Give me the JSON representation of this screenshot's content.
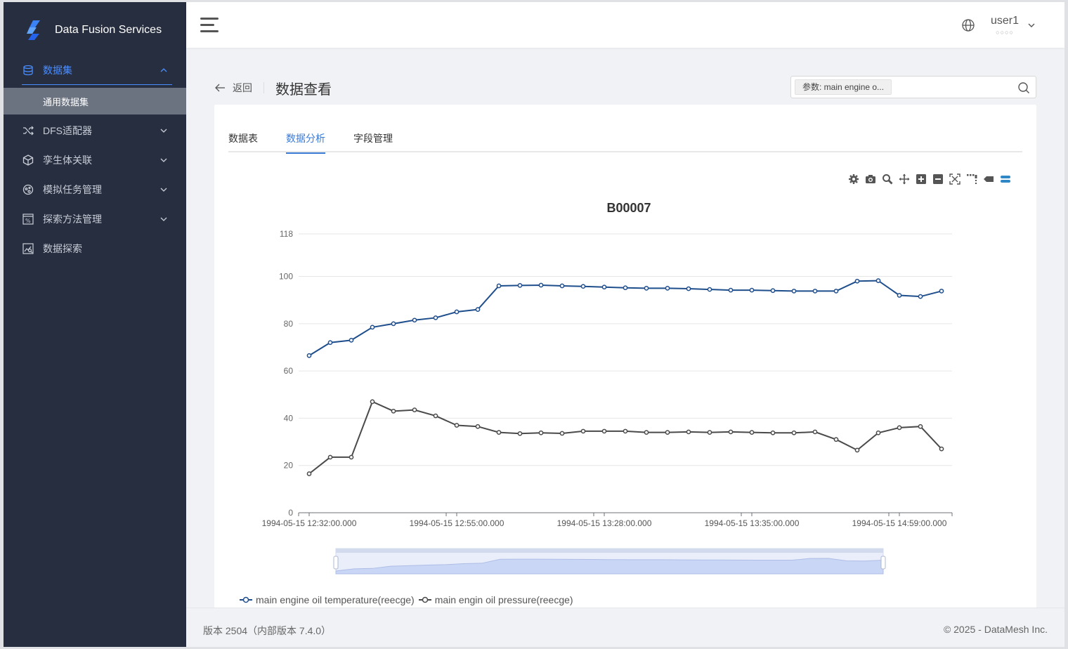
{
  "app": {
    "name": "Data Fusion Services"
  },
  "sidebar": {
    "items": [
      {
        "label": "数据集",
        "icon": "database-icon",
        "active": true
      },
      {
        "label": "通用数据集",
        "sub": true
      },
      {
        "label": "DFS适配器",
        "icon": "shuffle-icon"
      },
      {
        "label": "孪生体关联",
        "icon": "cube-icon"
      },
      {
        "label": "模拟任务管理",
        "icon": "task-icon"
      },
      {
        "label": "探索方法管理",
        "icon": "percent-icon"
      },
      {
        "label": "数据探索",
        "icon": "chart-explore-icon"
      }
    ]
  },
  "header": {
    "user_name": "user1",
    "user_sub": "○○○○"
  },
  "page": {
    "back_label": "返回",
    "title": "数据查看",
    "search_tag": "参数: main engine o..."
  },
  "tabs": [
    {
      "label": "数据表"
    },
    {
      "label": "数据分析",
      "active": true
    },
    {
      "label": "字段管理"
    }
  ],
  "toolbox": [
    "settings-icon",
    "camera-icon",
    "zoom-icon",
    "move-icon",
    "plus-box-icon",
    "minus-box-icon",
    "fullscreen-icon",
    "range-select-icon",
    "tag-icon",
    "legend-toggle-icon"
  ],
  "chart_data": {
    "type": "line",
    "title": "B00007",
    "ylim": [
      0,
      118
    ],
    "yticks": [
      0,
      20,
      40,
      60,
      80,
      100,
      118
    ],
    "x_tick_labels": [
      "1994-05-15 12:32:00.000",
      "1994-05-15 12:55:00.000",
      "1994-05-15 13:28:00.000",
      "1994-05-15 13:35:00.000",
      "1994-05-15 14:59:00.000"
    ],
    "grid": true,
    "legend_position": "bottom-left",
    "series": [
      {
        "name": "main engine oil temperature(reecge)",
        "color": "#1f4e8c",
        "values": [
          66.5,
          72,
          73,
          78.5,
          80,
          81.5,
          82.5,
          85,
          86,
          96,
          96.2,
          96.3,
          96,
          95.8,
          95.5,
          95.2,
          95,
          95,
          94.8,
          94.5,
          94.2,
          94.2,
          94,
          93.8,
          93.8,
          93.8,
          98,
          98.2,
          92,
          91.5,
          93.8
        ]
      },
      {
        "name": "main engin oil pressure(reecge)",
        "color": "#4a4a4a",
        "values": [
          16.5,
          23.5,
          23.5,
          47,
          43,
          43.5,
          41,
          37,
          36.5,
          34,
          33.5,
          33.8,
          33.6,
          34.5,
          34.5,
          34.5,
          34,
          34,
          34.2,
          34,
          34.2,
          34,
          33.8,
          33.8,
          34.2,
          31,
          26.5,
          33.8,
          36,
          36.5,
          27
        ]
      }
    ]
  },
  "footer": {
    "version": "版本 2504（内部版本 7.4.0）",
    "copyright": "© 2025 - DataMesh Inc."
  }
}
